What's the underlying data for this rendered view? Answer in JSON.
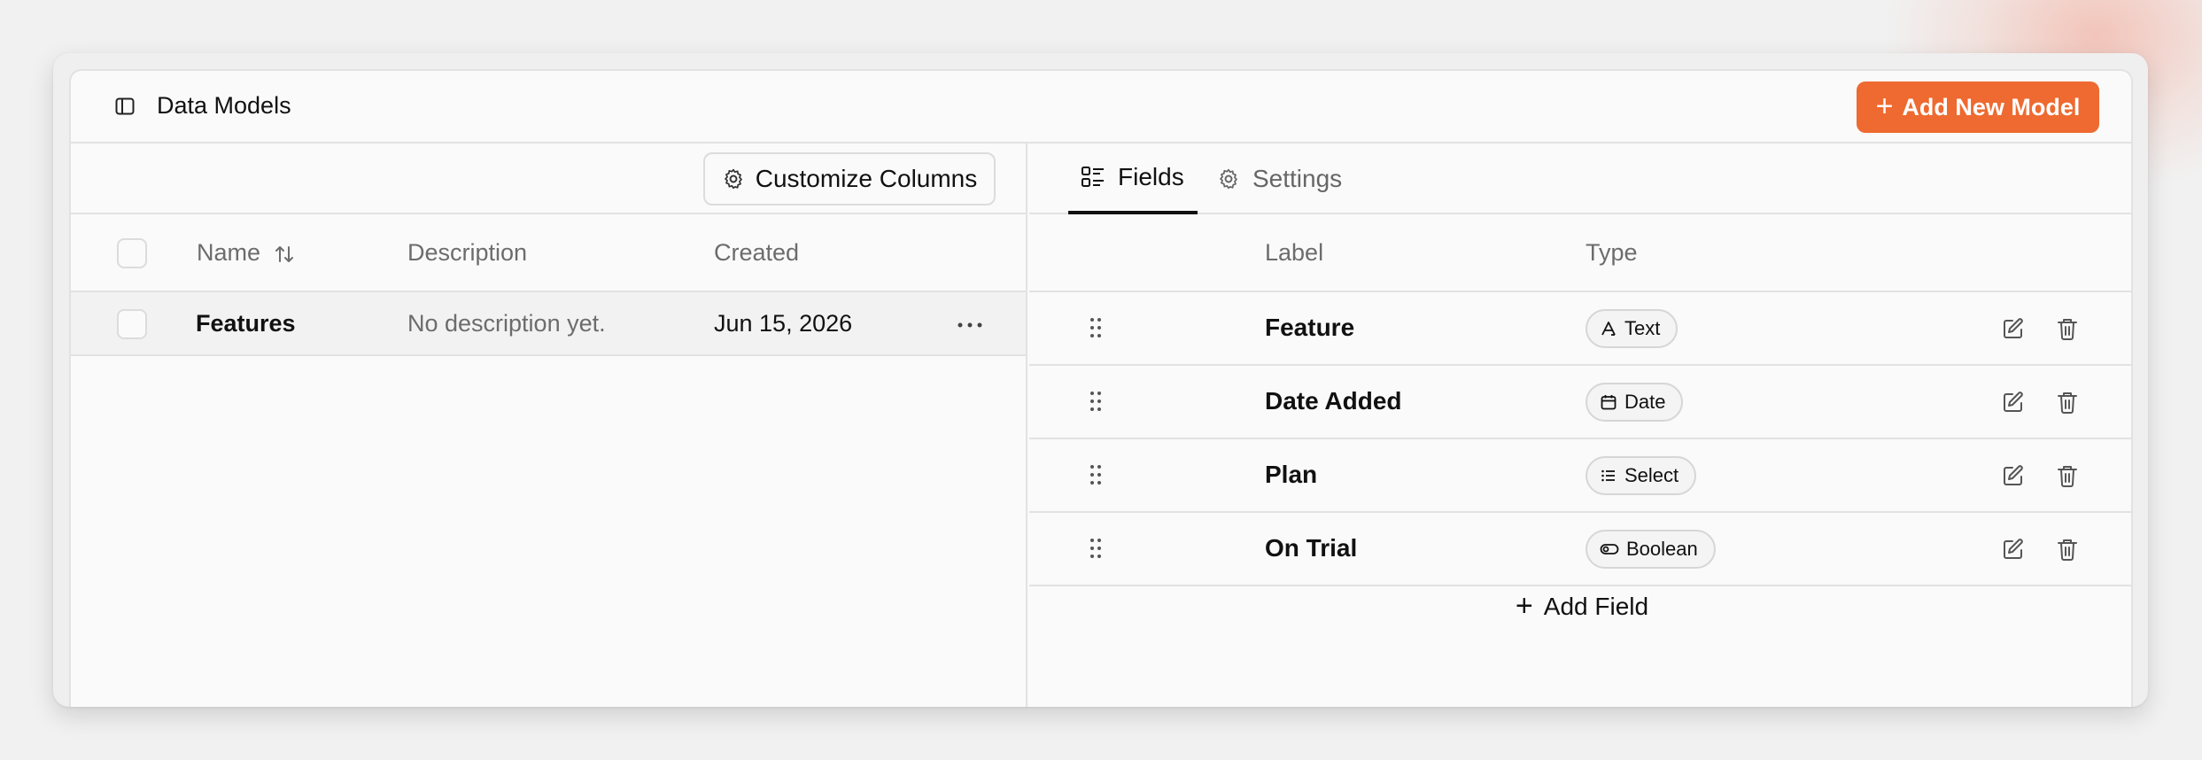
{
  "header": {
    "title": "Data Models",
    "add_model_label": "Add New Model"
  },
  "models_table": {
    "customize_label": "Customize Columns",
    "columns": [
      "Name",
      "Description",
      "Created"
    ],
    "rows": [
      {
        "name": "Features",
        "description": "No description yet.",
        "created": "Jun 15, 2026"
      }
    ]
  },
  "fields_panel": {
    "tabs": [
      {
        "label": "Fields",
        "active": true
      },
      {
        "label": "Settings",
        "active": false
      }
    ],
    "columns": [
      "Label",
      "Type"
    ],
    "fields": [
      {
        "label": "Feature",
        "type": "Text",
        "type_icon": "text-type-icon"
      },
      {
        "label": "Date Added",
        "type": "Date",
        "type_icon": "calendar-icon"
      },
      {
        "label": "Plan",
        "type": "Select",
        "type_icon": "list-icon"
      },
      {
        "label": "On Trial",
        "type": "Boolean",
        "type_icon": "toggle-icon"
      }
    ],
    "add_field_label": "Add Field"
  },
  "colors": {
    "accent": "#ee6a30",
    "border": "#e2e2e2",
    "muted_text": "#6c6c6c"
  }
}
